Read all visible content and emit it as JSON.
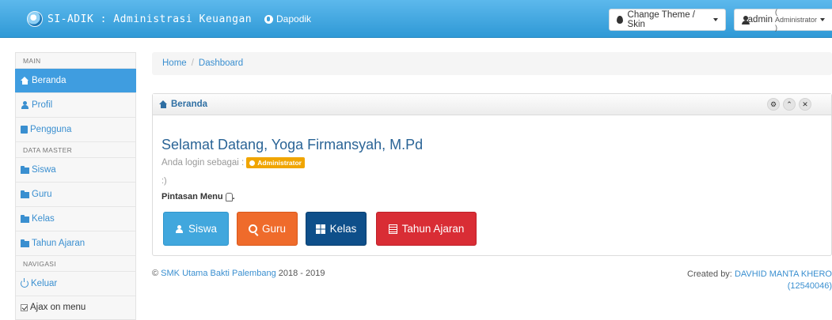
{
  "topbar": {
    "title": "SI-ADIK : Administrasi Keuangan",
    "dapodik_link": "Dapodik",
    "theme_button": "Change Theme / Skin",
    "user_name": "admin",
    "user_role": "( Administrator )"
  },
  "sidebar": {
    "sections": {
      "main": "MAIN",
      "data_master": "DATA MASTER",
      "navigasi": "NAVIGASI"
    },
    "items": {
      "beranda": "Beranda",
      "profil": "Profil",
      "pengguna": "Pengguna",
      "siswa": "Siswa",
      "guru": "Guru",
      "kelas": "Kelas",
      "tahun_ajaran": "Tahun Ajaran",
      "keluar": "Keluar"
    },
    "ajax_toggle": "Ajax on menu"
  },
  "breadcrumb": {
    "home": "Home",
    "separator": "/",
    "current": "Dashboard"
  },
  "panel": {
    "title": "Beranda",
    "welcome": "Selamat Datang, Yoga Firmansyah, M.Pd",
    "login_as": "Anda login sebagai :",
    "role_badge": "Administrator",
    "smiley": ":)",
    "shortcut_label": "Pintasan Menu",
    "shortcut_suffix": ".",
    "buttons": {
      "siswa": "Siswa",
      "guru": "Guru",
      "kelas": "Kelas",
      "tahun_ajaran": "Tahun Ajaran"
    }
  },
  "footer": {
    "copyright_symbol": "©",
    "school": "SMK Utama Bakti Palembang",
    "years": "2018 - 2019",
    "created_by": "Created by:",
    "author": "DAVHID MANTA KHERO",
    "author_id": "(12540046)"
  },
  "colors": {
    "topbar": "#3aa5e3",
    "accent": "#3f9de0",
    "badge": "#f0a500",
    "btn_siswa": "#41a7dd",
    "btn_guru": "#ef6b2b",
    "btn_kelas": "#0e4f8a",
    "btn_tahun": "#d92d35"
  }
}
